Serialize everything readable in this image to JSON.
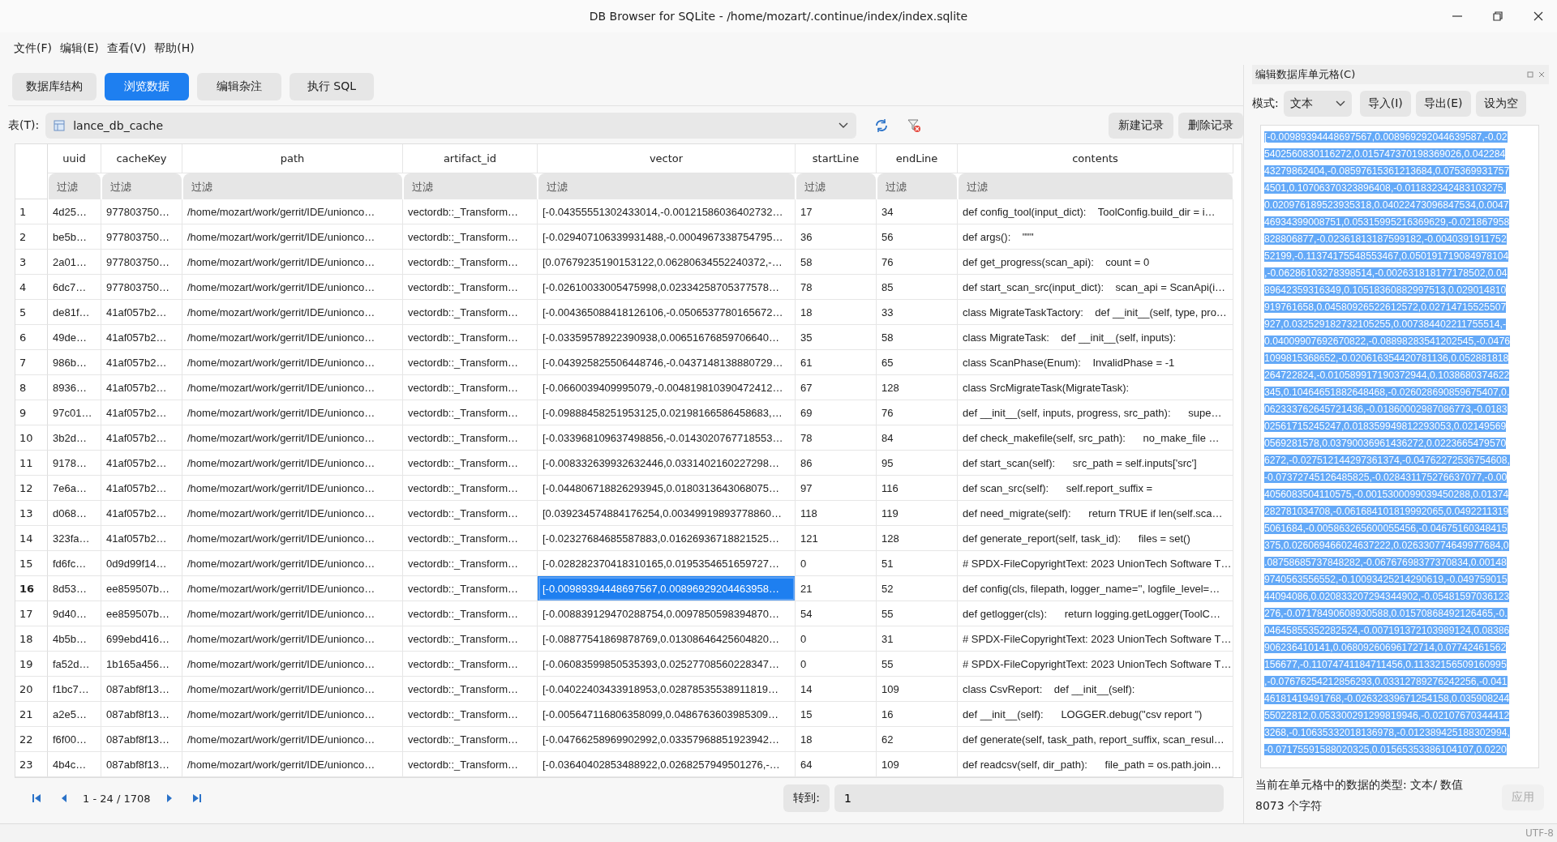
{
  "window": {
    "title": "DB Browser for SQLite - /home/mozart/.continue/index/index.sqlite"
  },
  "menu": [
    "文件(F)",
    "编辑(E)",
    "查看(V)",
    "帮助(H)"
  ],
  "tabs": [
    {
      "label": "数据库结构",
      "selected": false
    },
    {
      "label": "浏览数据",
      "selected": true
    },
    {
      "label": "编辑杂注",
      "selected": false
    },
    {
      "label": "执行 SQL",
      "selected": false
    }
  ],
  "table_bar": {
    "label": "表(T):",
    "table": "lance_db_cache",
    "buttons": [
      "新建记录",
      "删除记录"
    ]
  },
  "table": {
    "columns": [
      "uuid",
      "cacheKey",
      "path",
      "artifact_id",
      "vector",
      "startLine",
      "endLine",
      "contents"
    ],
    "filters": [
      {
        "placeholder": "过滤"
      },
      {
        "placeholder": "过滤"
      },
      {
        "placeholder": "过滤"
      },
      {
        "placeholder": "过滤"
      },
      {
        "placeholder": "过滤"
      },
      {
        "placeholder": "过滤"
      },
      {
        "placeholder": "过滤"
      },
      {
        "placeholder": "过滤"
      }
    ],
    "rows": [
      {
        "number": "1",
        "selected": false,
        "cells": [
          "4d25…",
          "977803750…",
          "/home/mozart/work/gerrit/IDE/unionco…",
          "vectordb::_Transform…",
          "[-0.04355551302433014,-0.00121586036402732…",
          "17",
          "34",
          "def config_tool(input_dict):    ToolConfig.build_dir = i…"
        ]
      },
      {
        "number": "2",
        "selected": false,
        "cells": [
          "be5b…",
          "977803750…",
          "/home/mozart/work/gerrit/IDE/unionco…",
          "vectordb::_Transform…",
          "[-0.029407106339931488,-0.0004967338754795…",
          "36",
          "56",
          "def args():    \"\"\""
        ]
      },
      {
        "number": "3",
        "selected": false,
        "cells": [
          "2a01…",
          "977803750…",
          "/home/mozart/work/gerrit/IDE/unionco…",
          "vectordb::_Transform…",
          "[0.07679235190153122,0.06280634552240372,-…",
          "58",
          "76",
          "def get_progress(scan_api):    count = 0"
        ]
      },
      {
        "number": "4",
        "selected": false,
        "cells": [
          "6dc7…",
          "977803750…",
          "/home/mozart/work/gerrit/IDE/unionco…",
          "vectordb::_Transform…",
          "[-0.02610033005475998,0.02334258705377578…",
          "78",
          "85",
          "def start_scan_src(input_dict):    scan_api = ScanApi(i…"
        ]
      },
      {
        "number": "5",
        "selected": false,
        "cells": [
          "de81f…",
          "41af057b2…",
          "/home/mozart/work/gerrit/IDE/unionco…",
          "vectordb::_Transform…",
          "[-0.004365088418126106,-0.0506537780165672…",
          "18",
          "33",
          "class MigrateTaskTactory:    def __init__(self, type, pro…"
        ]
      },
      {
        "number": "6",
        "selected": false,
        "cells": [
          "49de…",
          "41af057b2…",
          "/home/mozart/work/gerrit/IDE/unionco…",
          "vectordb::_Transform…",
          "[-0.03359578922390938,0.00651676859706640…",
          "35",
          "58",
          "class MigrateTask:    def __init__(self, inputs):"
        ]
      },
      {
        "number": "7",
        "selected": false,
        "cells": [
          "986b…",
          "41af057b2…",
          "/home/mozart/work/gerrit/IDE/unionco…",
          "vectordb::_Transform…",
          "[-0.043925825506448746,-0.0437148138880729…",
          "61",
          "65",
          "class ScanPhase(Enum):    InvalidPhase = -1"
        ]
      },
      {
        "number": "8",
        "selected": false,
        "cells": [
          "8936…",
          "41af057b2…",
          "/home/mozart/work/gerrit/IDE/unionco…",
          "vectordb::_Transform…",
          "[-0.0660039409995079,-0.004819810390472412…",
          "67",
          "128",
          "class SrcMigrateTask(MigrateTask):"
        ]
      },
      {
        "number": "9",
        "selected": false,
        "cells": [
          "97c01…",
          "41af057b2…",
          "/home/mozart/work/gerrit/IDE/unionco…",
          "vectordb::_Transform…",
          "[-0.09888458251953125,0.02198166586458683,…",
          "69",
          "76",
          "def __init__(self, inputs, progress, src_path):      supe…"
        ]
      },
      {
        "number": "10",
        "selected": false,
        "cells": [
          "3b2d…",
          "41af057b2…",
          "/home/mozart/work/gerrit/IDE/unionco…",
          "vectordb::_Transform…",
          "[-0.033968109637498856,-0.0143020767718553…",
          "78",
          "84",
          "def check_makefile(self, src_path):      no_make_file …"
        ]
      },
      {
        "number": "11",
        "selected": false,
        "cells": [
          "9178…",
          "41af057b2…",
          "/home/mozart/work/gerrit/IDE/unionco…",
          "vectordb::_Transform…",
          "[-0.008332639932632446,0.0331402160227298…",
          "86",
          "95",
          "def start_scan(self):      src_path = self.inputs['src']"
        ]
      },
      {
        "number": "12",
        "selected": false,
        "cells": [
          "7e6a…",
          "41af057b2…",
          "/home/mozart/work/gerrit/IDE/unionco…",
          "vectordb::_Transform…",
          "[-0.044806718826293945,0.0180313643068075…",
          "97",
          "116",
          "def scan_src(self):      self.report_suffix ="
        ]
      },
      {
        "number": "13",
        "selected": false,
        "cells": [
          "d068…",
          "41af057b2…",
          "/home/mozart/work/gerrit/IDE/unionco…",
          "vectordb::_Transform…",
          "[0.039234574884176254,0.00349919893778860…",
          "118",
          "119",
          "def need_migrate(self):      return TRUE if len(self.sca…"
        ]
      },
      {
        "number": "14",
        "selected": false,
        "cells": [
          "323fa…",
          "41af057b2…",
          "/home/mozart/work/gerrit/IDE/unionco…",
          "vectordb::_Transform…",
          "[-0.02327684685587883,0.01626936718821525…",
          "121",
          "128",
          "def generate_report(self, task_id):      files = set()"
        ]
      },
      {
        "number": "15",
        "selected": false,
        "cells": [
          "fd6fc…",
          "0d9d99f14…",
          "/home/mozart/work/gerrit/IDE/unionco…",
          "vectordb::_Transform…",
          "[-0.028282370418310165,0.0195354651659727…",
          "0",
          "51",
          "# SPDX-FileCopyrightText: 2023 UnionTech Software T…"
        ]
      },
      {
        "number": "16",
        "selected": true,
        "cells": [
          "8d53…",
          "ee859507b…",
          "/home/mozart/work/gerrit/IDE/unionco…",
          "vectordb::_Transform…",
          "[-0.00989394448697567,0.00896929204463958…",
          "21",
          "52",
          "def config(cls, filepath, logger_name='', logfile_level=…"
        ],
        "cell_selected": [
          false,
          false,
          false,
          false,
          true,
          false,
          false,
          false
        ]
      },
      {
        "number": "17",
        "selected": false,
        "cells": [
          "9d40…",
          "ee859507b…",
          "/home/mozart/work/gerrit/IDE/unionco…",
          "vectordb::_Transform…",
          "[-0.008839129470288754,0.0097850598394870…",
          "54",
          "55",
          "def getlogger(cls):      return logging.getLogger(ToolC…"
        ]
      },
      {
        "number": "18",
        "selected": false,
        "cells": [
          "4b5b…",
          "699ebd416…",
          "/home/mozart/work/gerrit/IDE/unionco…",
          "vectordb::_Transform…",
          "[-0.08877541869878769,0.01308646425604820…",
          "0",
          "31",
          "# SPDX-FileCopyrightText: 2023 UnionTech Software T…"
        ]
      },
      {
        "number": "19",
        "selected": false,
        "cells": [
          "fa52d…",
          "1b165a456…",
          "/home/mozart/work/gerrit/IDE/unionco…",
          "vectordb::_Transform…",
          "[-0.06083599850535393,0.02527708560228347…",
          "0",
          "55",
          "# SPDX-FileCopyrightText: 2023 UnionTech Software T…"
        ]
      },
      {
        "number": "20",
        "selected": false,
        "cells": [
          "f1bc7…",
          "087abf8f13…",
          "/home/mozart/work/gerrit/IDE/unionco…",
          "vectordb::_Transform…",
          "[-0.04022403433918953,0.02878535538911819…",
          "14",
          "109",
          "class CsvReport:    def __init__(self):"
        ]
      },
      {
        "number": "21",
        "selected": false,
        "cells": [
          "a2e5…",
          "087abf8f13…",
          "/home/mozart/work/gerrit/IDE/unionco…",
          "vectordb::_Transform…",
          "[-0.005647116806358099,0.0486763603985309…",
          "15",
          "16",
          "def __init__(self):      LOGGER.debug(\"csv report \")"
        ]
      },
      {
        "number": "22",
        "selected": false,
        "cells": [
          "f6f00…",
          "087abf8f13…",
          "/home/mozart/work/gerrit/IDE/unionco…",
          "vectordb::_Transform…",
          "[-0.04766258969902992,0.03357968851923942…",
          "18",
          "62",
          "def generate(self, task_path, report_suffix, scan_resul…"
        ]
      },
      {
        "number": "23",
        "selected": false,
        "cells": [
          "4b4c…",
          "087abf8f13…",
          "/home/mozart/work/gerrit/IDE/unionco…",
          "vectordb::_Transform…",
          "[-0.03640402853488922,0.0268257949501276,-…",
          "64",
          "109",
          "def readcsv(self, dir_path):      file_path = os.path.join…"
        ]
      }
    ]
  },
  "pagination": {
    "range": "1 - 24 / 1708",
    "goto_label": "转到:",
    "goto_value": "1"
  },
  "editor_panel": {
    "title": "编辑数据库单元格(C)",
    "mode_label": "模式:",
    "mode": "文本",
    "buttons": [
      "导入(I)",
      "导出(E)",
      "设为空"
    ],
    "text_lines": [
      "[-0.00989394448697567,0.008969292044639587,-0.02",
      "5402560830116272,0.015747370198369026,0.042284",
      "43279862404,-0.08597615361213684,0.075369931757",
      "4501,0.10706370323896408,-0.011832342483103275,",
      "0.020976189523935318,0.04022473096847534,0.0047",
      "46934399008751,0.05315995216369629,-0.021867958",
      "828806877,-0.02361813187599182,-0.0040391911752",
      "52199,-0.11374175548553467,0.050191719084978104",
      ",-0.06286103278398514,-0.002631818177178502,0.04",
      "89642359316349,0.10518360882997513,0.029014810",
      "919761658,0.04580926522612572,0.02714715525507",
      "927,0.032529182732105255,0.007384402211755514,-",
      "0.04009907692670822,-0.08898283541202545,-0.0476",
      "1099815368652,-0.020616354420781136,0.052881818",
      "264722824,-0.010589917190372944,0.1038680374622",
      "345,0.10464651882648468,-0.026028690859675407,0.",
      "062333762645721436,-0.01860002987086773,-0.0183",
      "02561715245247,0.018359949812293053,0.02149569",
      "0569281578,0.03790036961436272,0.0223665479570",
      "6272,-0.027512144297361374,-0.04762272536754608,",
      "-0.07372745126485825,-0.028431175276637077,-0.00",
      "4056083504110575,-0.0015300099039450288,0.01374",
      "282781034708,-0.061684101819992065,0.0492211319",
      "5061684,-0.005863265600055456,-0.04675160348415",
      "375,0.026069466024637222,0.026330774649977684,0",
      ".08758685737848282,-0.06767698377370834,0.00148",
      "9740563556552,-0.10093425214290619,-0.049759015",
      "44094086,0.020833207294344902,-0.05481597036123",
      "276,-0.07178490608930588,0.01570868492126465,-0.",
      "04645855352282524,-0.007191372103989124,0.08386",
      "906236410141,0.06809260696172714,0.07742461562",
      "156677,-0.11074741184711456,0.11332156509160995",
      ",-0.07676254212856293,0.03312789276242256,-0.041",
      "46181419491768,-0.02632339671254158,0.035908244",
      "55022812,0.053300291299819946,-0.02107670344412",
      "3268,-0.10635332018136978,-0.012389425188302994,",
      "-0.07175591588020325,0.01565353386104107,0.0220"
    ],
    "type_info": "当前在单元格中的数据的类型: 文本/ 数值",
    "char_count": "8073 个字符",
    "apply": {
      "label": "应用",
      "disabled": true
    }
  },
  "status_bar": {
    "encoding": "UTF-8"
  }
}
